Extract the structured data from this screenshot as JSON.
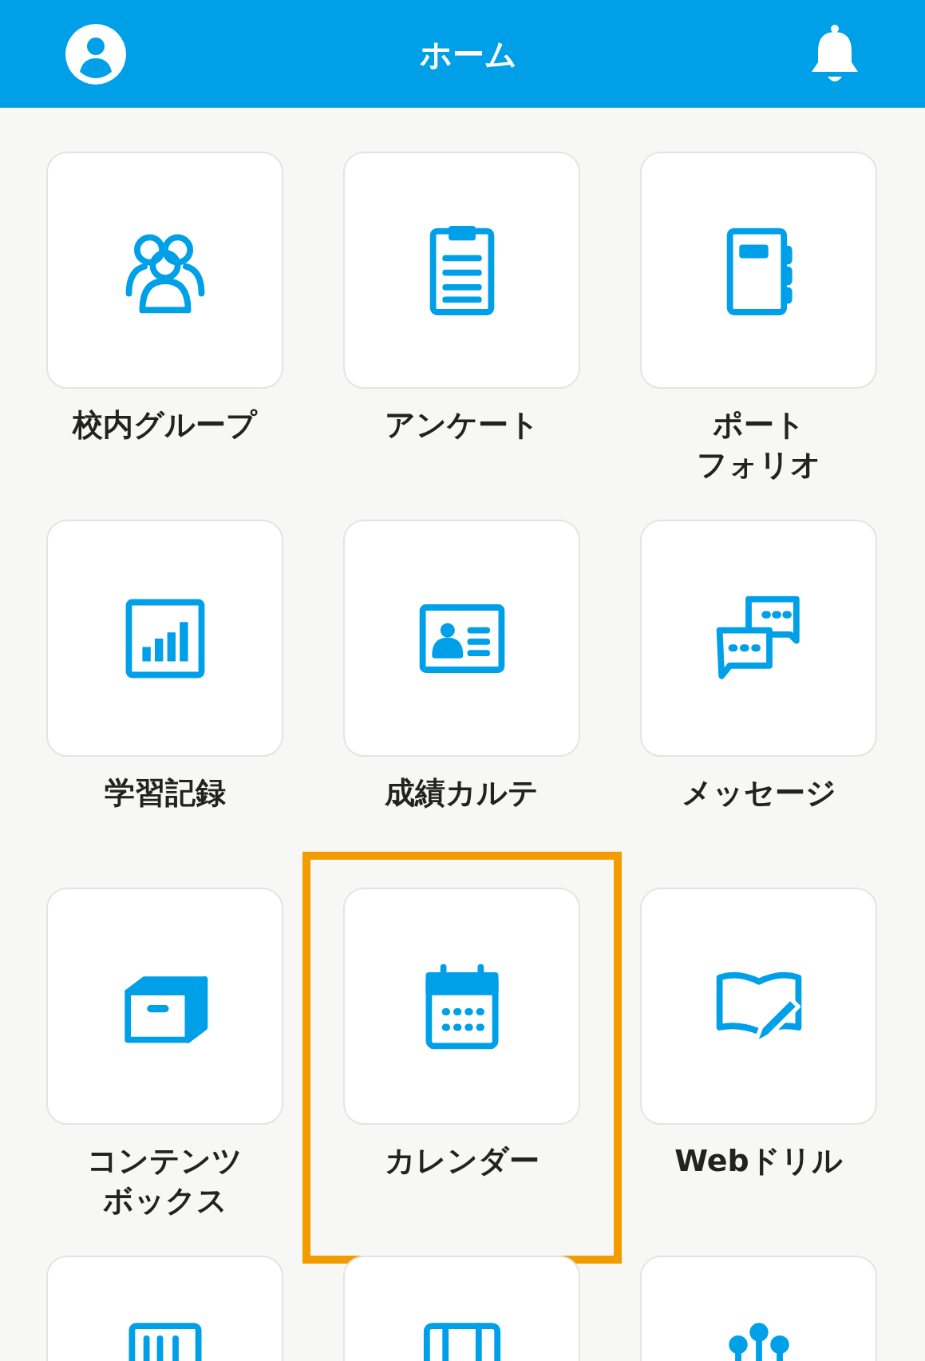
{
  "header": {
    "title": "ホーム"
  },
  "tiles": [
    {
      "label": "校内グループ",
      "highlighted": false
    },
    {
      "label": "アンケート",
      "highlighted": false
    },
    {
      "label": [
        "ポート",
        "フォリオ"
      ],
      "highlighted": false
    },
    {
      "label": "学習記録",
      "highlighted": false
    },
    {
      "label": "成績カルテ",
      "highlighted": false
    },
    {
      "label": "メッセージ",
      "highlighted": false
    },
    {
      "label": [
        "コンテンツ",
        "ボックス"
      ],
      "highlighted": false
    },
    {
      "label": "カレンダー",
      "highlighted": true
    },
    {
      "label": "Webドリル",
      "highlighted": false
    },
    {
      "highlighted": false
    },
    {
      "highlighted": false
    },
    {
      "highlighted": false
    }
  ]
}
